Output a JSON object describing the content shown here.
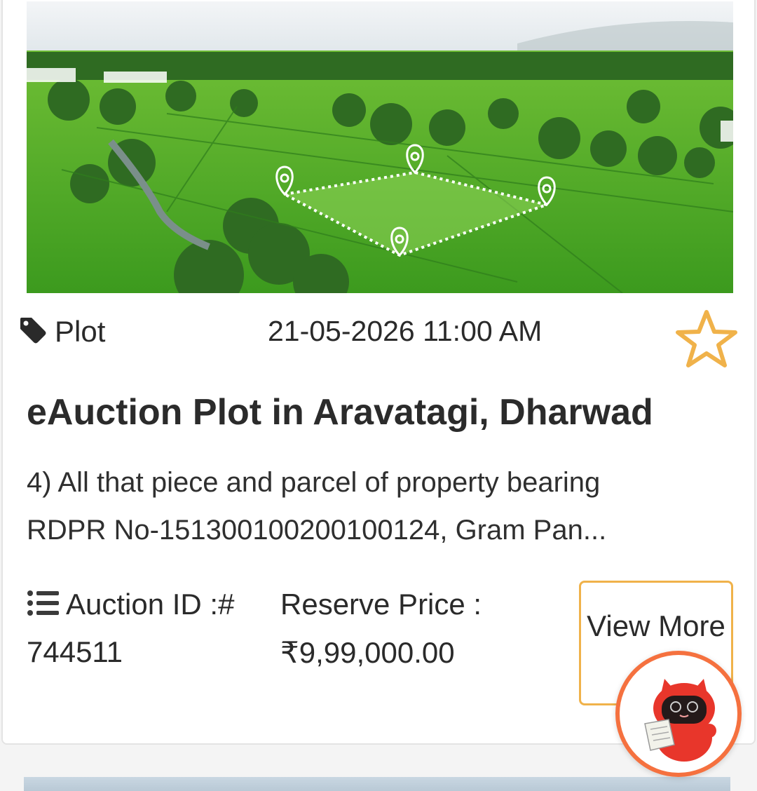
{
  "listing": {
    "category": "Plot",
    "datetime": "21-05-2026 11:00 AM",
    "title": "eAuction Plot in Aravatagi, Dharwad",
    "description_line1": "4) All that piece and parcel of property bearing",
    "description_line2": "RDPR No-151300100200100124, Gram Pan...",
    "auction_id_label": "Auction ID :#",
    "auction_id": "744511",
    "reserve_price_label": "Reserve Price :",
    "reserve_price": "₹9,99,000.00",
    "view_button_label": "View More"
  },
  "icons": {
    "tag": "tag-icon",
    "favorite": "star-outline-icon",
    "list": "list-icon",
    "assistant": "chatbot-mascot-icon"
  },
  "colors": {
    "accent": "#f0b24a",
    "assistant_ring": "#f5713f",
    "mascot": "#e8362b"
  }
}
